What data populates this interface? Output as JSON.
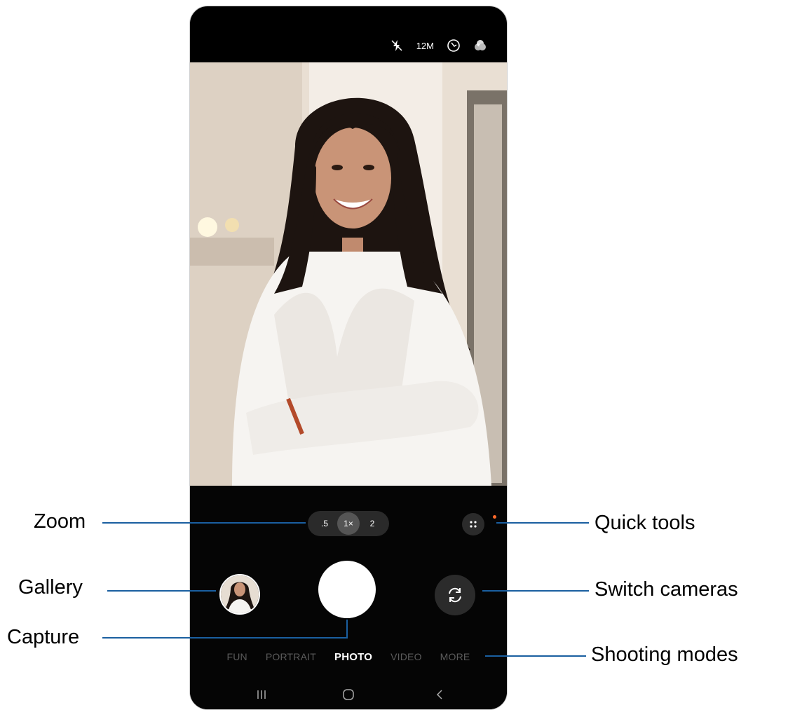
{
  "status": {
    "resolution_label": "12M",
    "icons": [
      "flash-off-icon",
      "timer-icon",
      "filter-icon"
    ]
  },
  "controls": {
    "zoom_options": [
      ".5",
      "1×",
      "2"
    ],
    "zoom_selected": "1×",
    "shooting_modes": [
      "FUN",
      "PORTRAIT",
      "PHOTO",
      "VIDEO",
      "MORE"
    ],
    "selected_mode": "PHOTO"
  },
  "callouts": {
    "zoom": "Zoom",
    "gallery": "Gallery",
    "capture": "Capture",
    "quick_tools": "Quick tools",
    "switch_cameras": "Switch cameras",
    "shooting_modes": "Shooting modes"
  },
  "colors": {
    "callout_line": "#1a5fa0",
    "notification_dot": "#ff6a2a",
    "background": "#000000"
  }
}
